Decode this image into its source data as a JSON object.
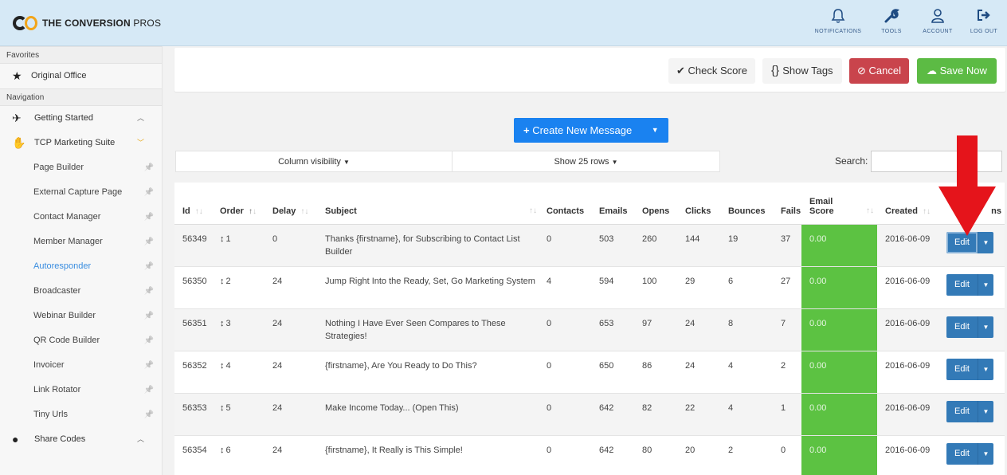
{
  "brand": {
    "name_bold": "THE CONVERSION",
    "name_rest": " PROS"
  },
  "top_nav": [
    {
      "label": "NOTIFICATIONS",
      "icon": "bell-icon",
      "glyph": "🔔"
    },
    {
      "label": "TOOLS",
      "icon": "wrench-icon",
      "glyph": "🔧"
    },
    {
      "label": "ACCOUNT",
      "icon": "user-icon",
      "glyph": "👤"
    },
    {
      "label": "LOG OUT",
      "icon": "logout-icon",
      "glyph": "➜"
    }
  ],
  "sidebar": {
    "favorites_label": "Favorites",
    "favorites": [
      {
        "label": "Original Office",
        "icon": "star-icon"
      }
    ],
    "navigation_label": "Navigation",
    "getting_started": "Getting Started",
    "marketing_suite": "TCP Marketing Suite",
    "sub_items": [
      "Page Builder",
      "External Capture Page",
      "Contact Manager",
      "Member Manager",
      "Autoresponder",
      "Broadcaster",
      "Webinar Builder",
      "QR Code Builder",
      "Invoicer",
      "Link Rotator",
      "Tiny Urls"
    ],
    "active_item": "Autoresponder",
    "share_codes": "Share Codes"
  },
  "actions": {
    "check_score": "Check Score",
    "show_tags": "Show Tags",
    "cancel": "Cancel",
    "save_now": "Save Now"
  },
  "create_message": "Create New Message",
  "controls": {
    "column_visibility": "Column visibility",
    "show_rows": "Show 25 rows",
    "search_label": "Search:",
    "search_value": ""
  },
  "table": {
    "headers": {
      "id": "Id",
      "order": "Order",
      "delay": "Delay",
      "subject": "Subject",
      "contacts": "Contacts",
      "emails": "Emails",
      "opens": "Opens",
      "clicks": "Clicks",
      "bounces": "Bounces",
      "fails": "Fails",
      "email_score_1": "Email",
      "email_score_2": "Score",
      "created": "Created",
      "actions": "ns"
    },
    "rows": [
      {
        "id": "56349",
        "order": "1",
        "delay": "0",
        "subject": "Thanks {firstname}, for Subscribing to Contact List Builder",
        "contacts": "0",
        "emails": "503",
        "opens": "260",
        "clicks": "144",
        "bounces": "19",
        "fails": "37",
        "score": "0.00",
        "created": "2016-06-09",
        "edit": "Edit"
      },
      {
        "id": "56350",
        "order": "2",
        "delay": "24",
        "subject": "Jump Right Into the Ready, Set, Go Marketing System",
        "contacts": "4",
        "emails": "594",
        "opens": "100",
        "clicks": "29",
        "bounces": "6",
        "fails": "27",
        "score": "0.00",
        "created": "2016-06-09",
        "edit": "Edit"
      },
      {
        "id": "56351",
        "order": "3",
        "delay": "24",
        "subject": "Nothing I Have Ever Seen Compares to These Strategies!",
        "contacts": "0",
        "emails": "653",
        "opens": "97",
        "clicks": "24",
        "bounces": "8",
        "fails": "7",
        "score": "0.00",
        "created": "2016-06-09",
        "edit": "Edit"
      },
      {
        "id": "56352",
        "order": "4",
        "delay": "24",
        "subject": "{firstname}, Are You Ready to Do This?",
        "contacts": "0",
        "emails": "650",
        "opens": "86",
        "clicks": "24",
        "bounces": "4",
        "fails": "2",
        "score": "0.00",
        "created": "2016-06-09",
        "edit": "Edit"
      },
      {
        "id": "56353",
        "order": "5",
        "delay": "24",
        "subject": "Make Income Today... (Open This)",
        "contacts": "0",
        "emails": "642",
        "opens": "82",
        "clicks": "22",
        "bounces": "4",
        "fails": "1",
        "score": "0.00",
        "created": "2016-06-09",
        "edit": "Edit"
      },
      {
        "id": "56354",
        "order": "6",
        "delay": "24",
        "subject": "{firstname}, It Really is This Simple!",
        "contacts": "0",
        "emails": "642",
        "opens": "80",
        "clicks": "20",
        "bounces": "2",
        "fails": "0",
        "score": "0.00",
        "created": "2016-06-09",
        "edit": "Edit"
      }
    ]
  },
  "colors": {
    "topbar": "#d6e9f6",
    "score_green": "#5cc242",
    "edit_blue": "#337ab7",
    "cancel_red": "#c9444c",
    "save_green": "#5cbb44",
    "create_blue": "#1a82f0",
    "annotation_arrow": "#e5141b"
  }
}
